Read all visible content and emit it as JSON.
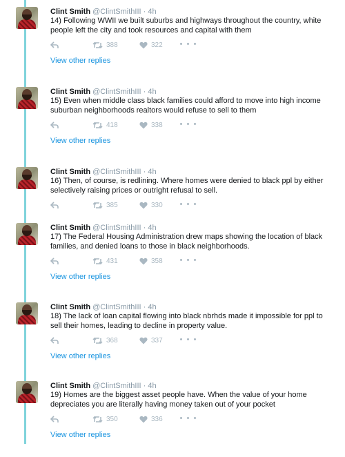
{
  "tweets": [
    {
      "name": "Clint Smith",
      "handle": "@ClintSmithIII",
      "time": "4h",
      "text": "14) Following WWII we built suburbs and highways throughout the country, white people left the city and took resources and capital with them",
      "retweets": "388",
      "likes": "322",
      "view_replies": "View other replies"
    },
    {
      "name": "Clint Smith",
      "handle": "@ClintSmithIII",
      "time": "4h",
      "text": "15) Even when middle class black families could afford to move into high income suburban neighborhoods realtors would refuse to sell to them",
      "retweets": "418",
      "likes": "338",
      "view_replies": "View other replies"
    },
    {
      "name": "Clint Smith",
      "handle": "@ClintSmithIII",
      "time": "4h",
      "text": "16) Then, of course, is redlining. Where homes were denied to black ppl by either selectively raising prices or outright refusal to sell.",
      "retweets": "385",
      "likes": "330",
      "view_replies": ""
    },
    {
      "name": "Clint Smith",
      "handle": "@ClintSmithIII",
      "time": "4h",
      "text": "17) The Federal Housing Administration drew maps showing the location of black families, and denied loans to those in black neighborhoods.",
      "retweets": "431",
      "likes": "358",
      "view_replies": "View other replies"
    },
    {
      "name": "Clint Smith",
      "handle": "@ClintSmithIII",
      "time": "4h",
      "text": "18) The lack of loan capital flowing into black nbrhds made it impossible for ppl to sell their homes, leading to decline in property value.",
      "retweets": "368",
      "likes": "337",
      "view_replies": "View other replies"
    },
    {
      "name": "Clint Smith",
      "handle": "@ClintSmithIII",
      "time": "4h",
      "text": "19) Homes are the biggest asset people have. When the value of your home depreciates you are literally having money taken out of your pocket",
      "retweets": "350",
      "likes": "336",
      "view_replies": "View other replies"
    }
  ],
  "colors": {
    "thread_line": "#7fd3db",
    "link": "#1b95e0",
    "icon": "#aab8c2"
  },
  "icons": [
    "reply-icon",
    "retweet-icon",
    "like-icon",
    "more-icon"
  ]
}
